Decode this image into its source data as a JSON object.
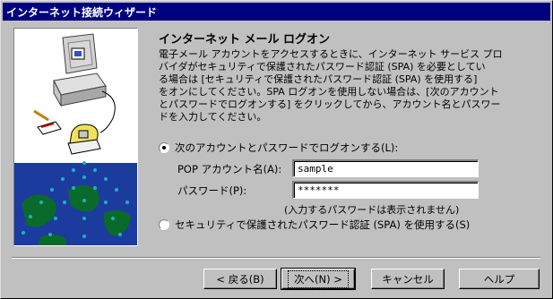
{
  "window": {
    "title": "インターネット接続ウィザード"
  },
  "page": {
    "heading": "インターネット メール ログオン",
    "description": "電子メール アカウントをアクセスするときに、インターネット サービス プロ\nバイダがセキュリティで保護されたパスワード認証 (SPA) を必要としてい\nる場合は [セキュリティで保護されたパスワード認証 (SPA) を使用する]\nをオンにしてください。SPA ログオンを使用しない場合は、[次のアカウント\nとパスワードでログオンする] をクリックしてから、アカウント名とパスワー\nドを入力してください。"
  },
  "options": {
    "account_password_label": "次のアカウントとパスワードでログオンする(L):",
    "spa_label": "セキュリティで保護されたパスワード認証 (SPA) を使用する(S)",
    "selected": "account_password"
  },
  "fields": {
    "account_label": "POP アカウント名(A):",
    "account_value": "sample",
    "password_label": "パスワード(P):",
    "password_value": "*******",
    "password_note": "(入力するパスワードは表示されません)"
  },
  "buttons": {
    "back": "< 戻る(B)",
    "next": "次へ(N) >",
    "cancel": "キャンセル",
    "help": "ヘルプ"
  },
  "colors": {
    "titlebar": "#000080",
    "dialog": "#c0c0c0",
    "art_blue": "#1c3b9e",
    "art_dots": "#20b0c0",
    "art_green": "#0a6a2a"
  }
}
